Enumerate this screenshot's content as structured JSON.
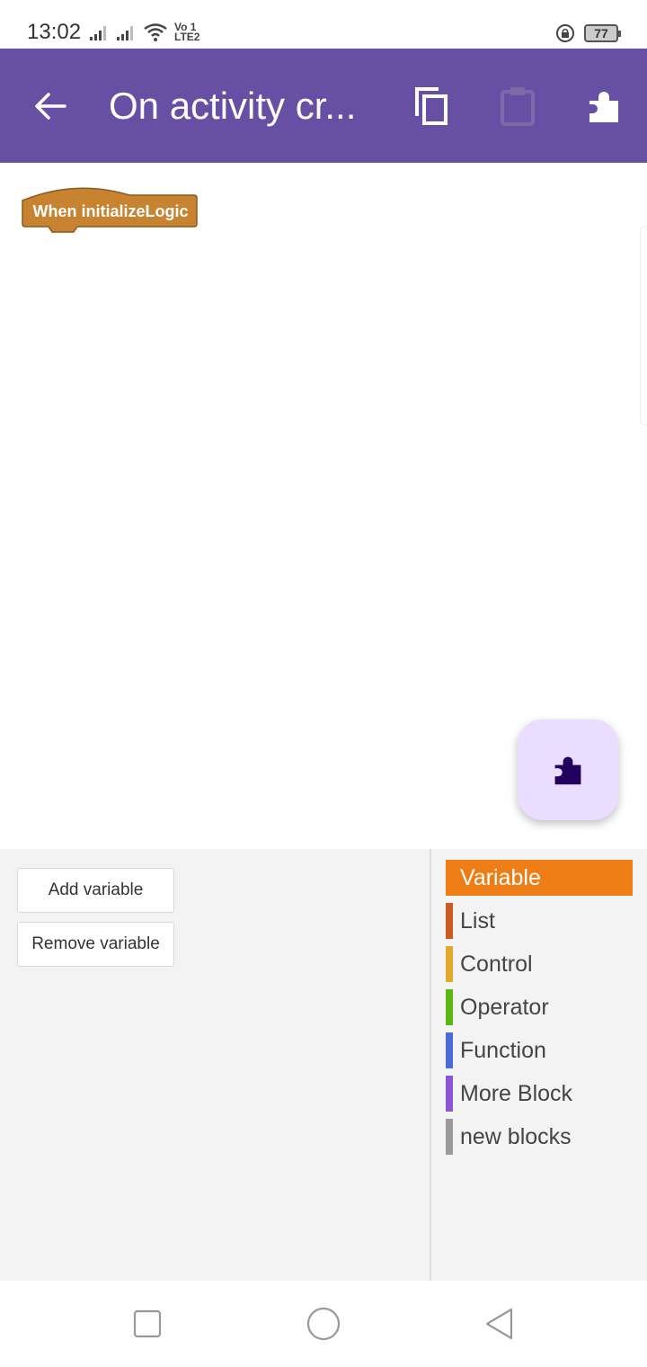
{
  "status_bar": {
    "time": "13:02",
    "volte_top": "Vo 1",
    "volte_bottom": "LTE2",
    "battery": "77"
  },
  "app_bar": {
    "title": "On activity cr...",
    "background": "#6750a4"
  },
  "canvas": {
    "hat_block": {
      "label": "When  initializeLogic",
      "color": "#c88330"
    }
  },
  "palette": {
    "buttons": [
      {
        "label": "Add variable"
      },
      {
        "label": "Remove variable"
      }
    ],
    "categories": [
      {
        "label": "Variable",
        "color": "#ef7d15",
        "selected": true
      },
      {
        "label": "List",
        "color": "#cc5b22"
      },
      {
        "label": "Control",
        "color": "#e1a92a"
      },
      {
        "label": "Operator",
        "color": "#5cb712"
      },
      {
        "label": "Function",
        "color": "#4a6cd4"
      },
      {
        "label": "More Block",
        "color": "#8a55d7"
      },
      {
        "label": "new blocks",
        "color": "#9a9a9a"
      }
    ]
  },
  "icons": {
    "back": "arrow-back-icon",
    "copy": "copy-icon",
    "paste": "clipboard-icon",
    "component": "puzzle-icon",
    "fab": "puzzle-icon",
    "nav_recents": "square-icon",
    "nav_home": "circle-icon",
    "nav_back": "triangle-back-icon"
  }
}
